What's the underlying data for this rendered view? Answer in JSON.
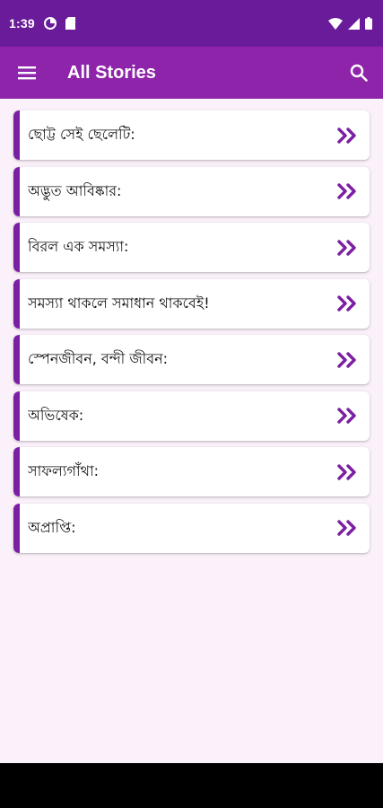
{
  "status_bar": {
    "time": "1:39",
    "icons_left": [
      "data-saver-icon",
      "sd-card-icon"
    ],
    "icons_right": [
      "wifi-icon",
      "cell-signal-icon",
      "battery-icon"
    ]
  },
  "app_bar": {
    "title": "All Stories",
    "menu_icon": "hamburger-menu-icon",
    "search_icon": "search-icon"
  },
  "stories": [
    {
      "title": "ছোট্ট সেই ছেলেটি:"
    },
    {
      "title": "অদ্ভুত আবিষ্কার:"
    },
    {
      "title": "বিরল এক সমস্যা:"
    },
    {
      "title": "সমস্যা থাকলে সমাধান থাকবেই!"
    },
    {
      "title": "স্পেনজীবন, বন্দী জীবন:"
    },
    {
      "title": "অভিষেক:"
    },
    {
      "title": "সাফল্যগাঁথা:"
    },
    {
      "title": "অপ্রাপ্তি:"
    }
  ],
  "colors": {
    "status_bar": "#6a1b9a",
    "app_bar": "#8e24aa",
    "accent": "#7b1fa2",
    "background": "#fbf1fb"
  }
}
